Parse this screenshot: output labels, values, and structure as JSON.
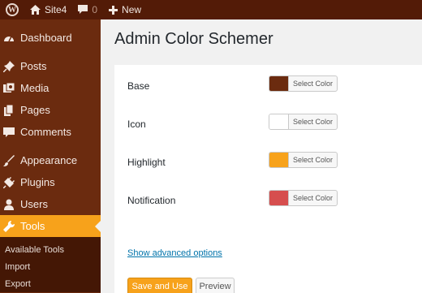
{
  "adminbar": {
    "site_name": "Site4",
    "comment_count": "0",
    "new_label": "New",
    "icons": [
      "wordpress-logo-icon",
      "home-icon",
      "comment-bubble-icon",
      "plus-icon"
    ]
  },
  "sidebar": {
    "items": [
      {
        "label": "Dashboard",
        "icon": "dashboard-icon"
      },
      {
        "label": "Posts",
        "icon": "pushpin-icon"
      },
      {
        "label": "Media",
        "icon": "media-icon"
      },
      {
        "label": "Pages",
        "icon": "pages-icon"
      },
      {
        "label": "Comments",
        "icon": "comment-icon"
      },
      {
        "label": "Appearance",
        "icon": "paintbrush-icon"
      },
      {
        "label": "Plugins",
        "icon": "plug-icon"
      },
      {
        "label": "Users",
        "icon": "user-icon"
      },
      {
        "label": "Tools",
        "icon": "wrench-icon",
        "active": true
      }
    ],
    "submenu": [
      "Available Tools",
      "Import",
      "Export"
    ]
  },
  "main": {
    "title": "Admin Color Schemer",
    "rows": [
      {
        "label": "Base",
        "color": "#6b2b0f",
        "button": "Select Color"
      },
      {
        "label": "Icon",
        "color": "#ffffff",
        "button": "Select Color"
      },
      {
        "label": "Highlight",
        "color": "#f7a21b",
        "button": "Select Color"
      },
      {
        "label": "Notification",
        "color": "#d64e4e",
        "button": "Select Color"
      }
    ],
    "advanced_link": "Show advanced options",
    "save_button": "Save and Use",
    "preview_button": "Preview"
  },
  "colors": {
    "adminbar_bg": "#531b07",
    "sidebar_bg": "#6b2b0f",
    "highlight": "#f7a21b",
    "link": "#0073aa"
  }
}
